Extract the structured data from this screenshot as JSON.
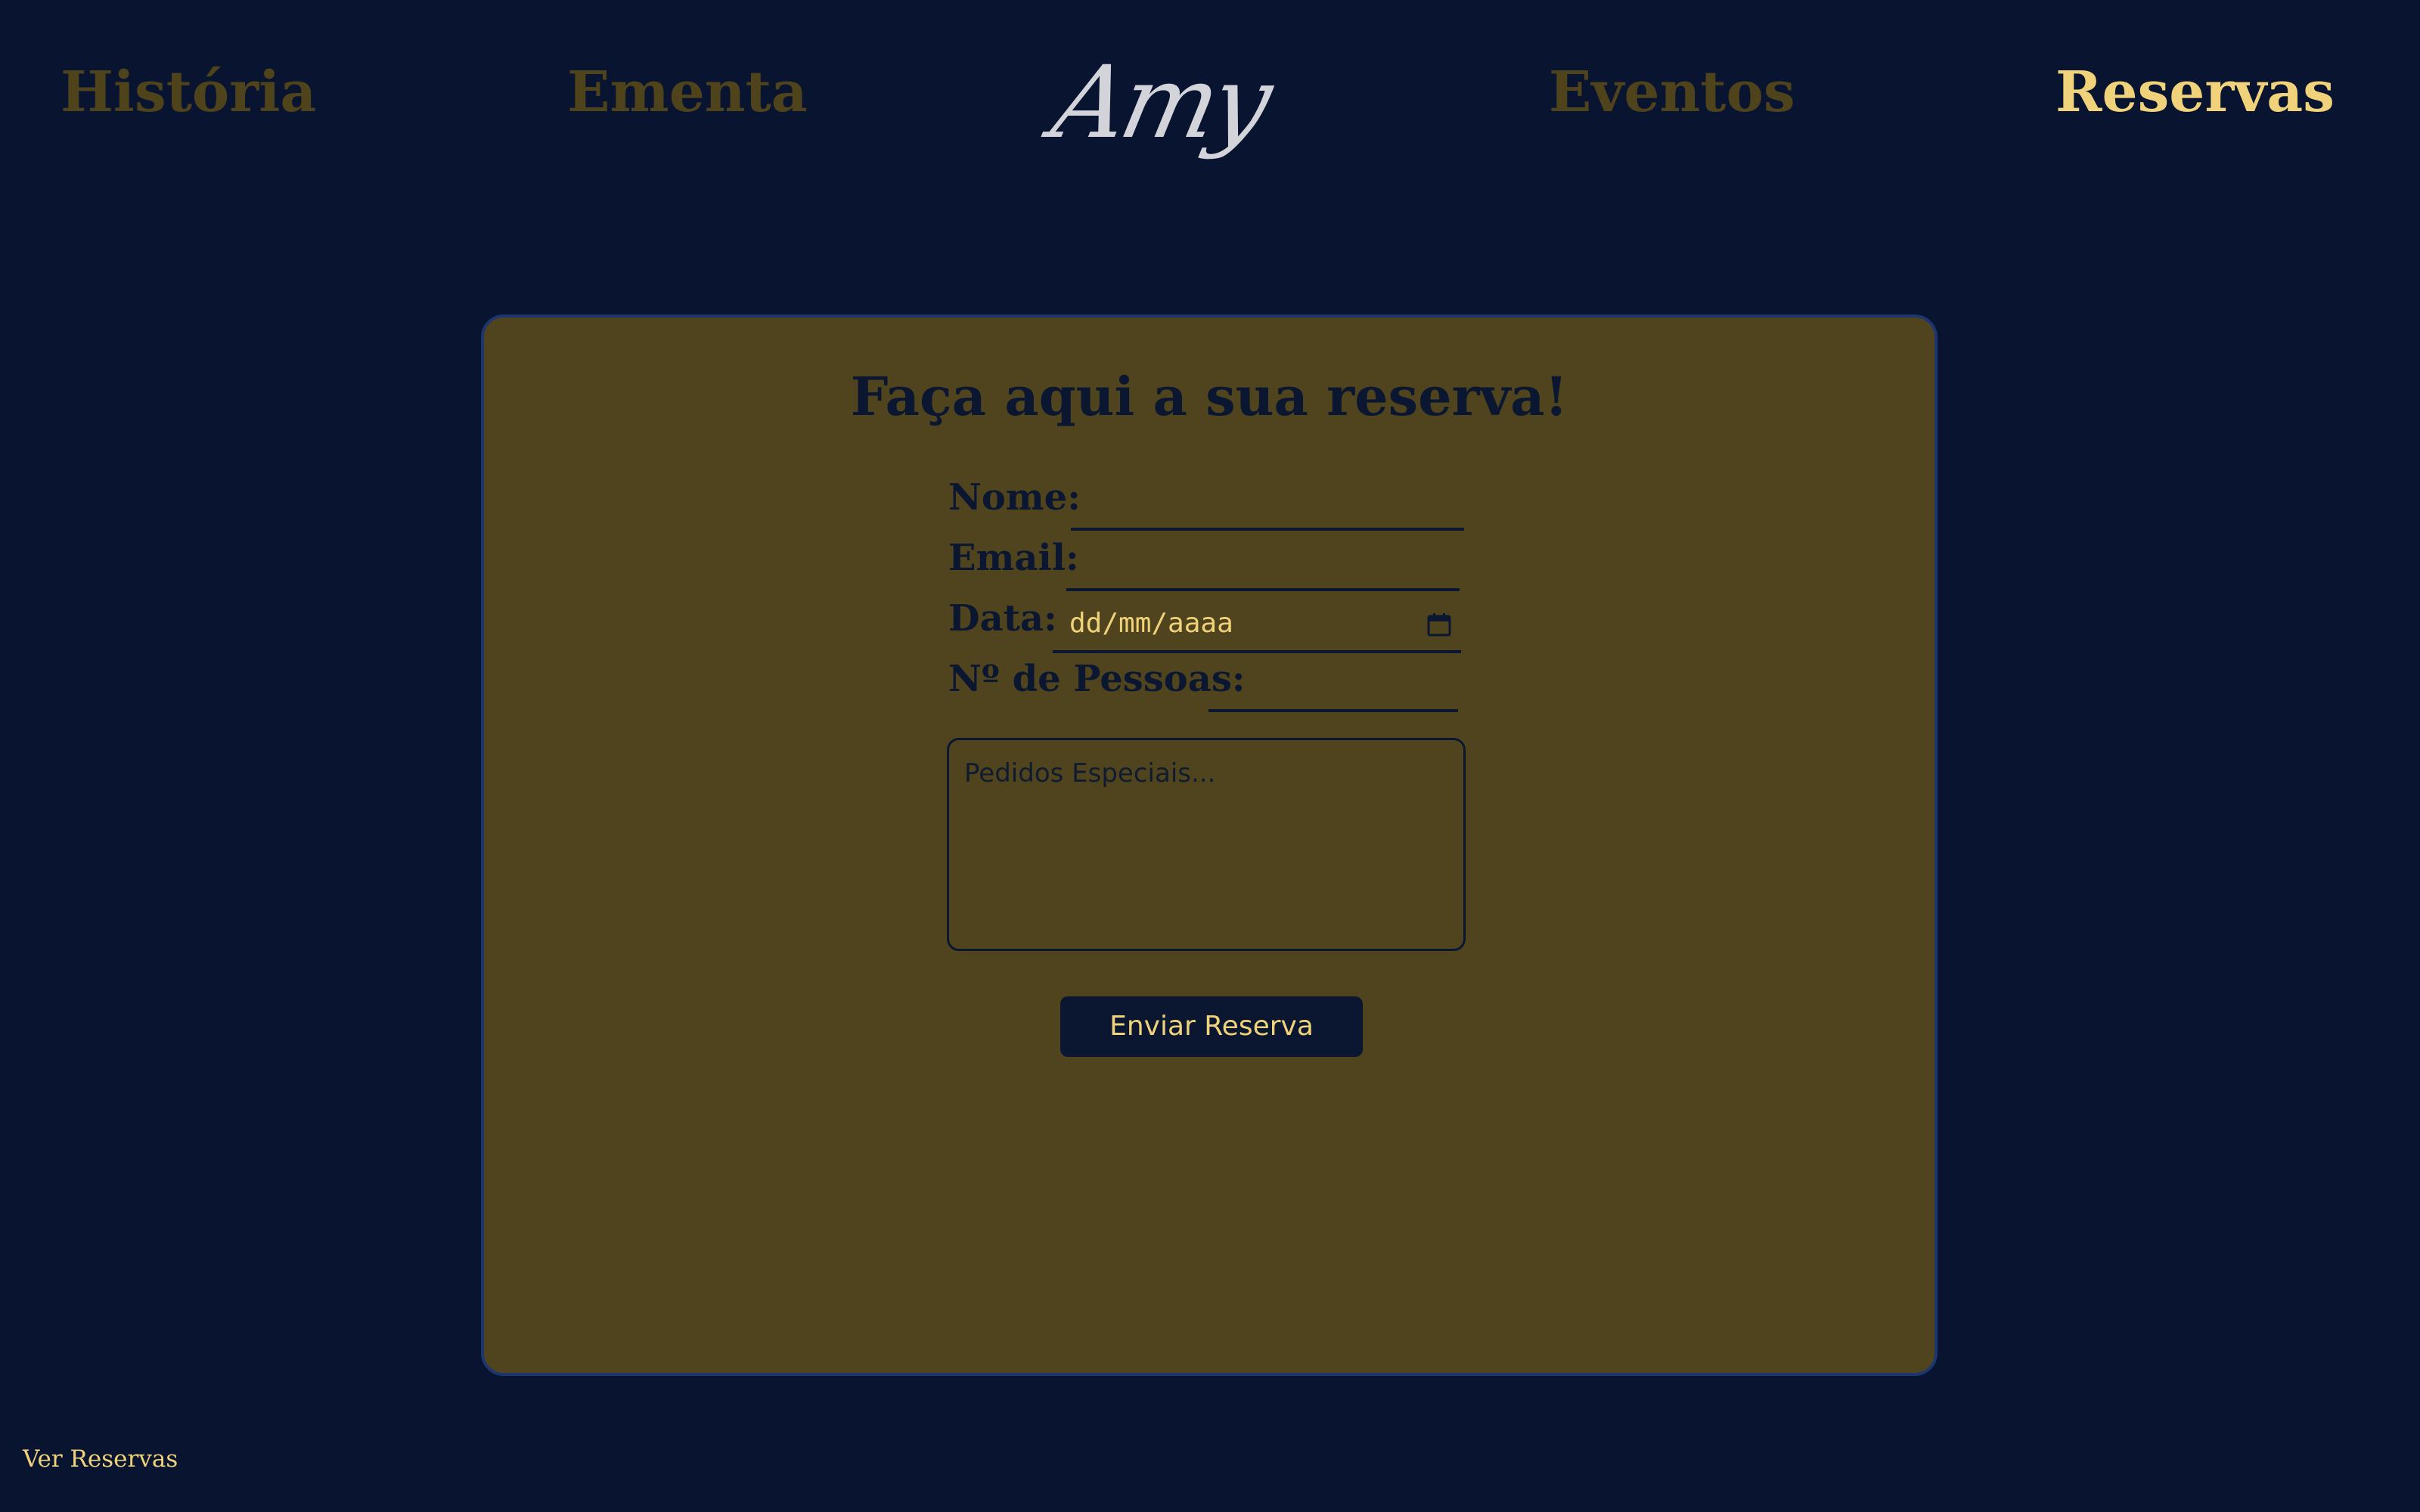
{
  "header": {
    "nav": [
      {
        "label": "História",
        "active": false
      },
      {
        "label": "Ementa",
        "active": false
      },
      {
        "label": "Eventos",
        "active": false
      },
      {
        "label": "Reservas",
        "active": true
      }
    ],
    "logo_text": "Amy"
  },
  "form": {
    "title": "Faça aqui a sua reserva!",
    "fields": {
      "nome": {
        "label": "Nome:",
        "value": ""
      },
      "email": {
        "label": "Email:",
        "value": ""
      },
      "data": {
        "label": "Data:",
        "placeholder": "dd/mm/aaaa",
        "icon": "calendar-icon"
      },
      "pessoas": {
        "label": "Nº de Pessoas:",
        "value": ""
      }
    },
    "special_requests": {
      "placeholder": "Pedidos Especiais..."
    },
    "submit_label": "Enviar Reserva"
  },
  "footer": {
    "link_label": "Ver Reservas"
  },
  "colors": {
    "background": "#081430",
    "card": "#4f441d",
    "card_border": "#1e3670",
    "accent": "#f0d27a",
    "nav_inactive": "#4f431c",
    "text_dark": "#0b1731",
    "logo": "#d2d4da"
  }
}
